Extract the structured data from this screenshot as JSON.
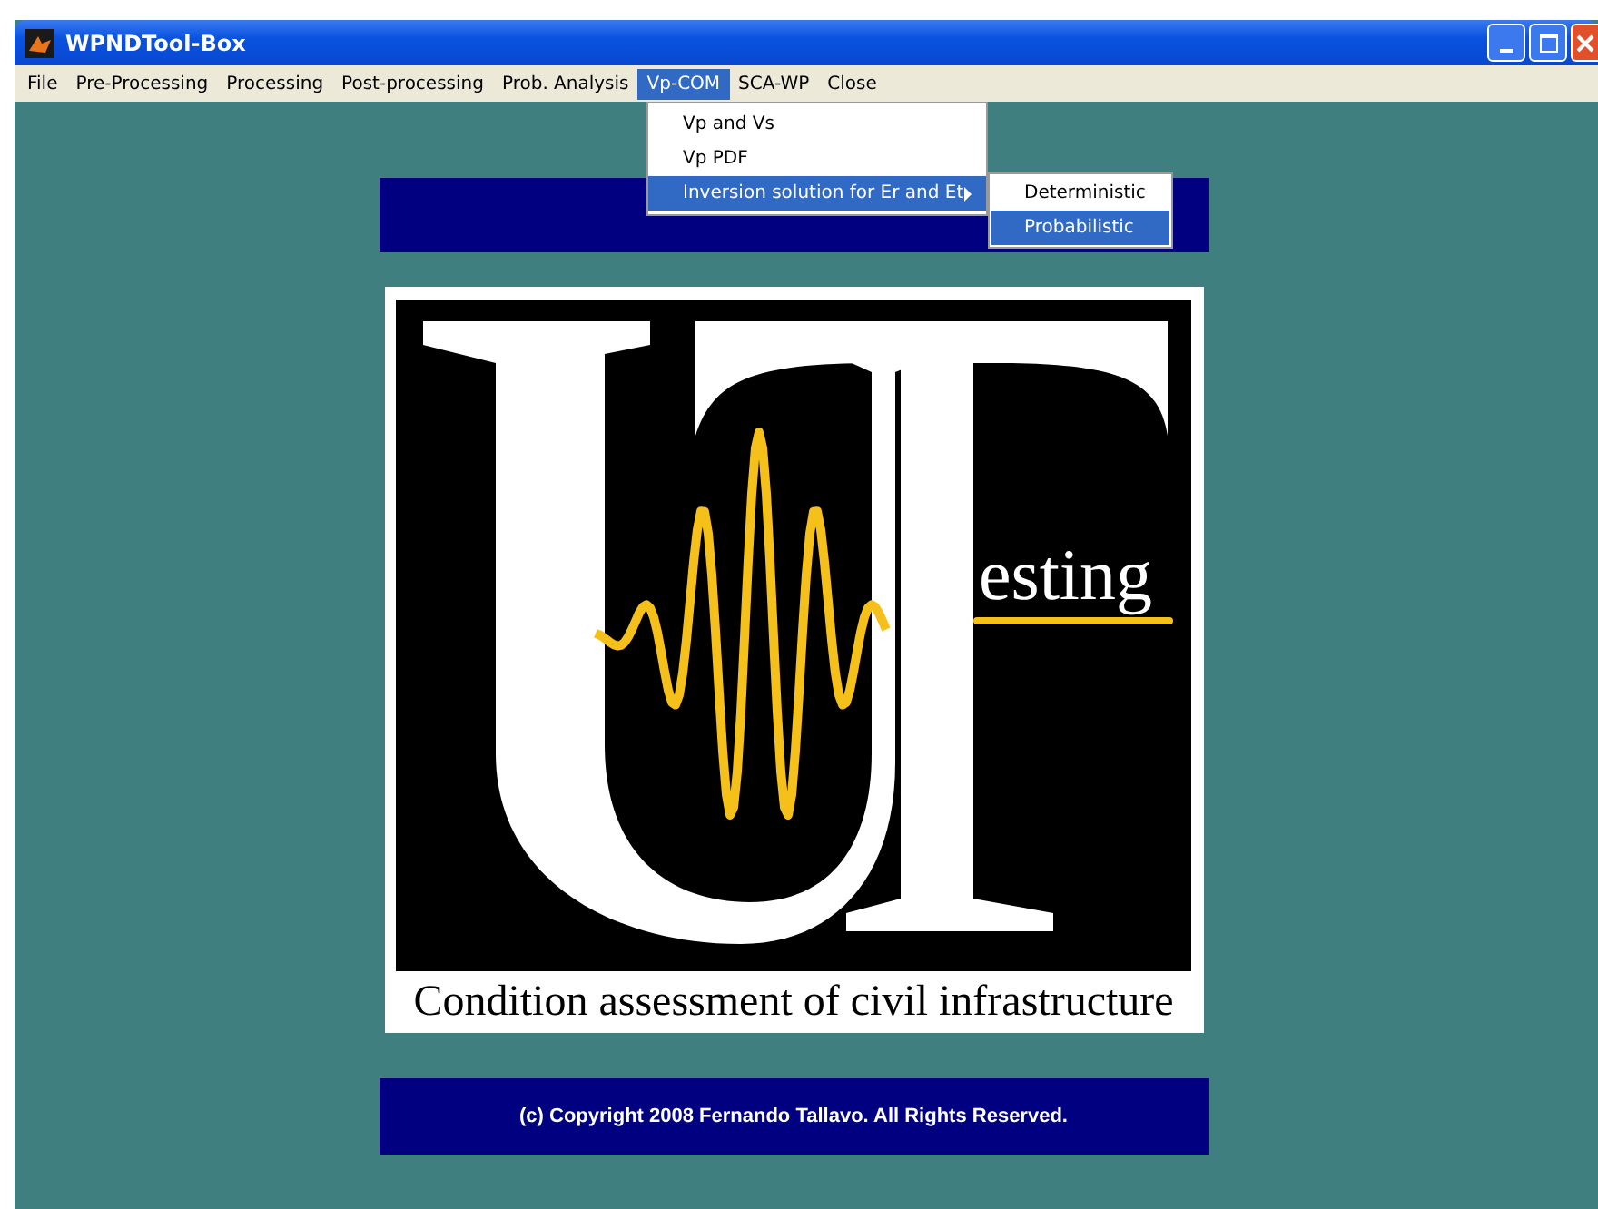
{
  "window": {
    "title": "WPNDTool-Box"
  },
  "menu_bar": [
    {
      "label": "File",
      "selected": false
    },
    {
      "label": "Pre-Processing",
      "selected": false
    },
    {
      "label": "Processing",
      "selected": false
    },
    {
      "label": "Post-processing",
      "selected": false
    },
    {
      "label": "Prob. Analysis",
      "selected": false
    },
    {
      "label": "Vp-COM",
      "selected": true
    },
    {
      "label": "SCA-WP",
      "selected": false
    },
    {
      "label": "Close",
      "selected": false
    }
  ],
  "dropdown": {
    "items": [
      {
        "label": "Vp and Vs",
        "selected": false,
        "has_submenu": false
      },
      {
        "label": "Vp PDF",
        "selected": false,
        "has_submenu": false
      },
      {
        "label": "Inversion solution for Er and Et",
        "selected": true,
        "has_submenu": true
      }
    ]
  },
  "submenu": {
    "items": [
      {
        "label": "Deterministic",
        "selected": false
      },
      {
        "label": "Probabilistic",
        "selected": true
      }
    ]
  },
  "logo": {
    "suffix": "esting",
    "caption": "Condition assessment of civil infrastructure"
  },
  "footer": {
    "copyright": "(c) Copyright 2008 Fernando Tallavo. All Rights Reserved."
  }
}
